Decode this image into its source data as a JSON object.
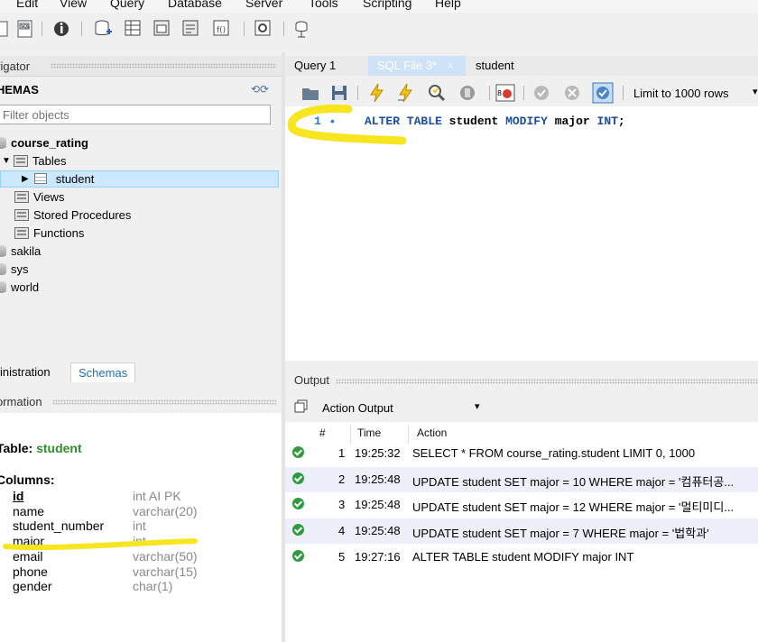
{
  "menu": [
    "Edit",
    "View",
    "Query",
    "Database",
    "Server",
    "Tools",
    "Scripting",
    "Help"
  ],
  "navigator": {
    "header": "vigator",
    "schemas_title": "HEMAS",
    "filter_placeholder": "Filter objects",
    "tree": {
      "course_rating": "course_rating",
      "tables": "Tables",
      "student": "student",
      "views": "Views",
      "procedures": "Stored Procedures",
      "functions": "Functions",
      "sakila": "sakila",
      "sys": "sys",
      "world": "world"
    },
    "admin_tab": "inistration",
    "schemas_tab": "Schemas",
    "info_header": "ormation"
  },
  "info": {
    "table_label": "Table:",
    "table_name": "student",
    "columns_label": "Columns:",
    "columns": [
      {
        "name": "id",
        "type": "int AI PK"
      },
      {
        "name": "name",
        "type": "varchar(20)"
      },
      {
        "name": "student_number",
        "type": "int"
      },
      {
        "name": "major",
        "type": "int"
      },
      {
        "name": "email",
        "type": "varchar(50)"
      },
      {
        "name": "phone",
        "type": "varchar(15)"
      },
      {
        "name": "gender",
        "type": "char(1)"
      }
    ]
  },
  "tabs": {
    "query1": "Query 1",
    "sqlfile": "SQL File 3*",
    "student": "student"
  },
  "editor": {
    "limit_label": "Limit to 1000 rows",
    "line_number": "1",
    "kw1": "ALTER TABLE",
    "ident1": "student",
    "kw2": "MODIFY",
    "ident2": "major",
    "kw3": "INT",
    "semi": ";"
  },
  "output": {
    "header": "Output",
    "dropdown": "Action Output",
    "col_num": "#",
    "col_time": "Time",
    "col_action": "Action",
    "rows": [
      {
        "num": "1",
        "time": "19:25:32",
        "action": "SELECT * FROM course_rating.student LIMIT 0, 1000"
      },
      {
        "num": "2",
        "time": "19:25:48",
        "action": "UPDATE student SET major = 10 WHERE major = '컴퓨터공..."
      },
      {
        "num": "3",
        "time": "19:25:48",
        "action": "UPDATE student SET major = 12 WHERE major = '멀티미디..."
      },
      {
        "num": "4",
        "time": "19:25:48",
        "action": "UPDATE student SET major = 7 WHERE major = '법학과'"
      },
      {
        "num": "5",
        "time": "19:27:16",
        "action": "ALTER TABLE student MODIFY major INT"
      }
    ]
  },
  "colors": {
    "keyword": "#1a4fa0",
    "highlight": "#f7e51f",
    "success": "#2e9b3f",
    "schema_green": "#2f8f2f"
  }
}
